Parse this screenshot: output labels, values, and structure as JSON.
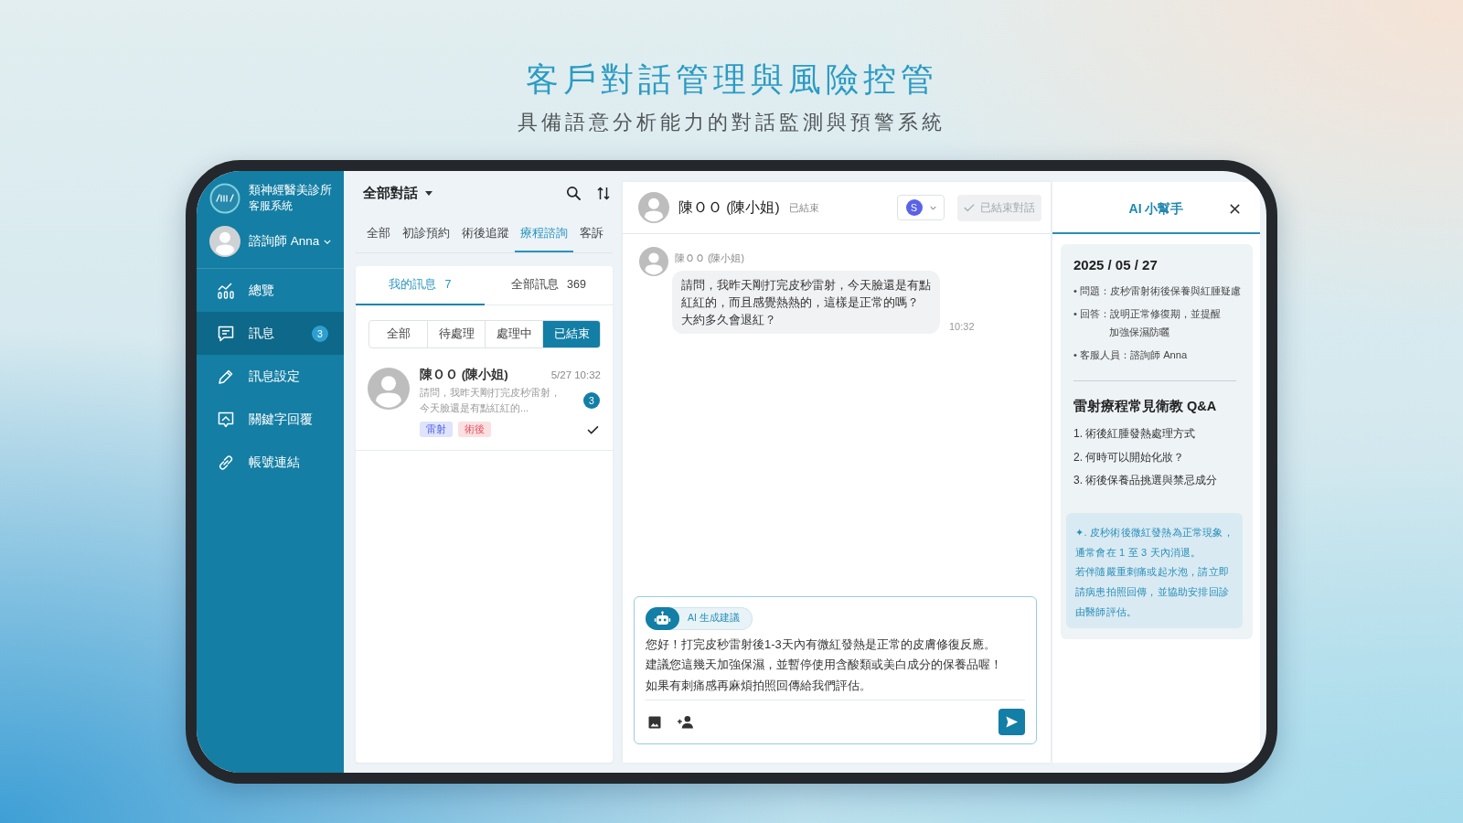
{
  "hero": {
    "title": "客戶對話管理與風險控管",
    "subtitle": "具備語意分析能力的對話監測與預警系統"
  },
  "sidebar": {
    "brand": "類神經醫美診所",
    "brand_subtitle": "客服系統",
    "user": "諮詢師 Anna",
    "items": [
      {
        "label": "總覽",
        "selected": false
      },
      {
        "label": "訊息",
        "selected": true,
        "badge": "3"
      },
      {
        "label": "訊息設定",
        "selected": false
      },
      {
        "label": "關鍵字回覆",
        "selected": false
      },
      {
        "label": "帳號連結",
        "selected": false
      }
    ]
  },
  "conversation_list": {
    "title": "全部對話",
    "tabs": [
      {
        "label": "全部",
        "selected": false
      },
      {
        "label": "初診預約",
        "selected": false
      },
      {
        "label": "術後追蹤",
        "selected": false
      },
      {
        "label": "療程諮詢",
        "selected": true
      },
      {
        "label": "客訴",
        "selected": false
      }
    ],
    "subtabs": [
      {
        "label": "我的訊息",
        "count": "7",
        "selected": true
      },
      {
        "label": "全部訊息",
        "count": "369",
        "selected": false
      }
    ],
    "filters": [
      {
        "label": "全部",
        "selected": false
      },
      {
        "label": "待處理",
        "selected": false
      },
      {
        "label": "處理中",
        "selected": false
      },
      {
        "label": "已結束",
        "selected": true
      }
    ],
    "items": [
      {
        "name": "陳ＯＯ (陳小姐)",
        "time": "5/27 10:32",
        "preview": [
          "請問，我昨天剛打完皮秒雷射，",
          "今天臉還是有點紅紅的..."
        ],
        "unread": "3",
        "tags": [
          {
            "label": "雷射",
            "color": "#dfe3fb"
          },
          {
            "label": "術後",
            "color": "#fbe0e2"
          }
        ],
        "done": true,
        "selected": false
      }
    ]
  },
  "chat": {
    "contact": "陳ＯＯ (陳小姐)",
    "status": "已結束",
    "assignee": "S",
    "end_button": {
      "label": "已結束對話",
      "disabled": true
    },
    "messages": [
      {
        "sender": "陳ＯＯ (陳小姐)",
        "lines": [
          "請問，我昨天剛打完皮秒雷射，今天臉還是有點",
          "紅紅的，而且感覺熱熱的，這樣是正常的嗎？",
          "大約多久會退紅？"
        ],
        "time": "10:32"
      }
    ],
    "composer": {
      "chip": "AI 生成建議",
      "lines": [
        "您好！打完皮秒雷射後1-3天內有微紅發熱是正常的皮膚修復反應。",
        "建議您這幾天加強保濕，並暫停使用含酸類或美白成分的保養品喔！",
        "如果有刺痛感再麻煩拍照回傳給我們評估。"
      ]
    }
  },
  "assistant": {
    "title": "AI 小幫手",
    "date": "2025 / 05 / 27",
    "summary": [
      {
        "lines": [
          "• 問題：皮秒雷射術後保養與紅腫疑慮"
        ]
      },
      {
        "lines": [
          "• 回答：說明正常修復期，並提醒",
          "加強保濕防曬"
        ]
      },
      {
        "lines": [
          "• 客服人員：諮詢師 Anna"
        ]
      }
    ],
    "qa_title": "雷射療程常見衛教 Q&A",
    "qa": [
      "1. 術後紅腫發熱處理方式",
      "2. 何時可以開始化妝？",
      "3. 術後保養品挑選與禁忌成分"
    ],
    "tip": [
      "✦. 皮秒術後微紅發熱為正常現象，",
      "通常會在 1 至 3 天內消退。",
      "若伴隨嚴重刺痛或起水泡，請立即",
      "請病患拍照回傳，並協助安排回診",
      "由醫師評估。"
    ]
  }
}
